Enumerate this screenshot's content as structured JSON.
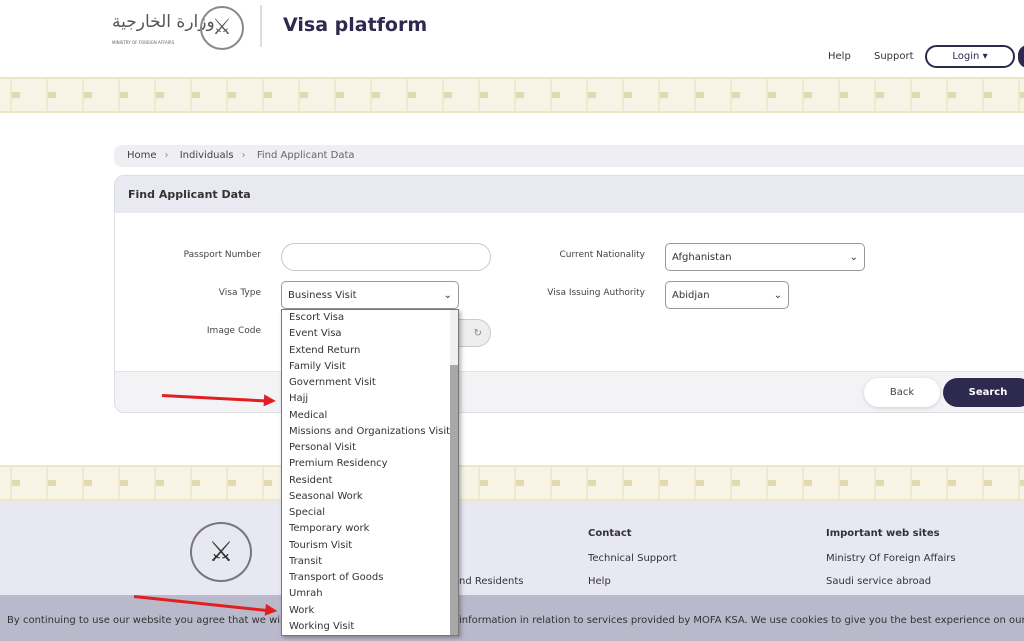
{
  "header": {
    "title": "Visa platform",
    "logo_text": "MINISTRY OF FOREIGN AFFAIRS",
    "nav": {
      "help": "Help",
      "support": "Support",
      "login": "Login ▾"
    }
  },
  "breadcrumb": [
    "Home",
    "Individuals",
    "Find Applicant Data"
  ],
  "card": {
    "title": "Find Applicant Data",
    "fields": {
      "passport_label": "Passport Number",
      "passport_value": "",
      "nationality_label": "Current Nationality",
      "nationality_value": "Afghanistan",
      "visa_type_label": "Visa Type",
      "visa_type_value": "Business Visit",
      "authority_label": "Visa Issuing Authority",
      "authority_value": "Abidjan",
      "image_code_label": "Image Code"
    },
    "back": "Back",
    "search": "Search"
  },
  "dropdown_options": [
    "Escort Visa",
    "Event Visa",
    "Extend Return",
    "Family Visit",
    "Government Visit",
    "Hajj",
    "Medical",
    "Missions and Organizations Visit",
    "Personal Visit",
    "Premium Residency",
    "Resident",
    "Seasonal Work",
    "Special",
    "Temporary work",
    "Tourism Visit",
    "Transit",
    "Transport of Goods",
    "Umrah",
    "Work",
    "Working Visit"
  ],
  "footer": {
    "partial_link": "nd Residents",
    "contact_title": "Contact",
    "contact_links": [
      "Technical Support",
      "Help"
    ],
    "sites_title": "Important web sites",
    "sites_links": [
      "Ministry Of Foreign Affairs",
      "Saudi service abroad"
    ]
  },
  "cookie": {
    "left": "By continuing to use our website you agree that we will",
    "right": "information in relation to services provided by MOFA KSA. We use cookies to give you the best experience on our w"
  },
  "colors": {
    "primary": "#2e2a4f",
    "annotation": "#e02020"
  }
}
